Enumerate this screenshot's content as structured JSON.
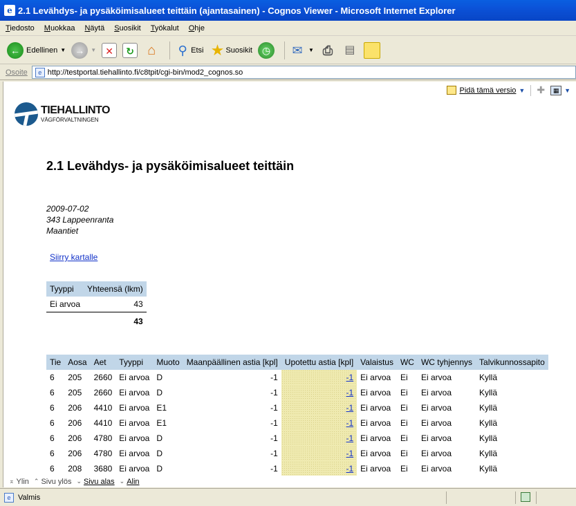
{
  "window": {
    "title": "2.1 Levähdys- ja pysäköimisalueet teittäin (ajantasainen) - Cognos Viewer - Microsoft Internet Explorer"
  },
  "menu": [
    "Tiedosto",
    "Muokkaa",
    "Näytä",
    "Suosikit",
    "Työkalut",
    "Ohje"
  ],
  "toolbar": {
    "back_label": "Edellinen",
    "search_label": "Etsi",
    "favorites_label": "Suosikit"
  },
  "address": {
    "label": "Osoite",
    "url": "http://testportal.tiehallinto.fi/c8tpit/cgi-bin/mod2_cognos.so"
  },
  "viewer": {
    "keep_version": "Pidä tämä versio"
  },
  "logo": {
    "name": "TIEHALLINTO",
    "sub": "VÄGFÖRVALTNINGEN"
  },
  "report": {
    "title": "2.1 Levähdys- ja pysäköimisalueet teittäin",
    "date": "2009-07-02",
    "area": "343 Lappeenranta",
    "roadtype": "Maantiet",
    "map_link": "Siirry kartalle"
  },
  "summary": {
    "headers": [
      "Tyyppi",
      "Yhteensä (lkm)"
    ],
    "rows": [
      [
        "Ei arvoa",
        "43"
      ]
    ],
    "total": "43"
  },
  "table": {
    "headers": [
      "Tie",
      "Aosa",
      "Aet",
      "Tyyppi",
      "Muoto",
      "Maanpäällinen astia [kpl]",
      "Upotettu astia [kpl]",
      "Valaistus",
      "WC",
      "WC tyhjennys",
      "Talvikunnossapito"
    ],
    "rows": [
      [
        "6",
        "205",
        "2660",
        "Ei arvoa",
        "D",
        "-1",
        "-1",
        "Ei arvoa",
        "Ei",
        "Ei arvoa",
        "Kyllä"
      ],
      [
        "6",
        "205",
        "2660",
        "Ei arvoa",
        "D",
        "-1",
        "-1",
        "Ei arvoa",
        "Ei",
        "Ei arvoa",
        "Kyllä"
      ],
      [
        "6",
        "206",
        "4410",
        "Ei arvoa",
        "E1",
        "-1",
        "-1",
        "Ei arvoa",
        "Ei",
        "Ei arvoa",
        "Kyllä"
      ],
      [
        "6",
        "206",
        "4410",
        "Ei arvoa",
        "E1",
        "-1",
        "-1",
        "Ei arvoa",
        "Ei",
        "Ei arvoa",
        "Kyllä"
      ],
      [
        "6",
        "206",
        "4780",
        "Ei arvoa",
        "D",
        "-1",
        "-1",
        "Ei arvoa",
        "Ei",
        "Ei arvoa",
        "Kyllä"
      ],
      [
        "6",
        "206",
        "4780",
        "Ei arvoa",
        "D",
        "-1",
        "-1",
        "Ei arvoa",
        "Ei",
        "Ei arvoa",
        "Kyllä"
      ],
      [
        "6",
        "208",
        "3680",
        "Ei arvoa",
        "D",
        "-1",
        "-1",
        "Ei arvoa",
        "Ei",
        "Ei arvoa",
        "Kyllä"
      ]
    ]
  },
  "pagenav": {
    "top": "Ylin",
    "up": "Sivu ylös",
    "down": "Sivu alas",
    "bottom": "Alin"
  },
  "status": {
    "text": "Valmis"
  }
}
